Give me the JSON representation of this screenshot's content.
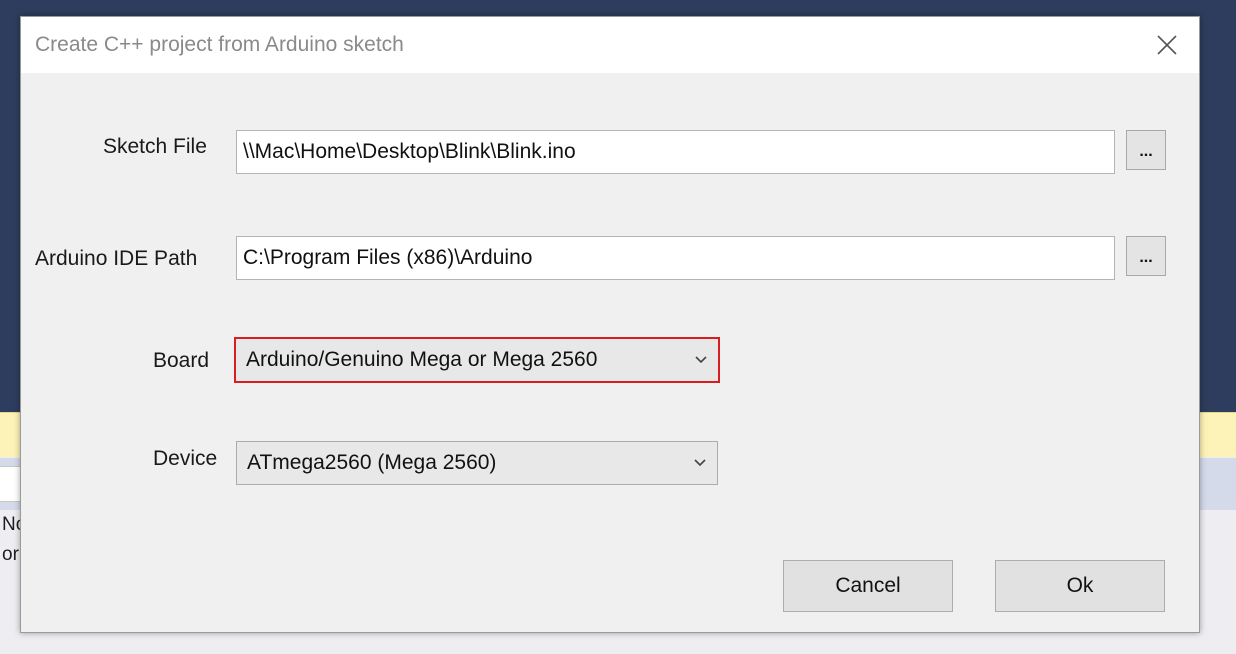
{
  "dialog": {
    "title": "Create C++ project from Arduino sketch"
  },
  "fields": {
    "sketch_file": {
      "label": "Sketch File",
      "value": "\\\\Mac\\Home\\Desktop\\Blink\\Blink.ino",
      "browse_label": "..."
    },
    "ide_path": {
      "label": "Arduino IDE Path",
      "value": "C:\\Program Files (x86)\\Arduino",
      "browse_label": "..."
    },
    "board": {
      "label": "Board",
      "selected": "Arduino/Genuino Mega or Mega 2560"
    },
    "device": {
      "label": "Device",
      "selected": "ATmega2560 (Mega 2560)"
    }
  },
  "buttons": {
    "cancel": "Cancel",
    "ok": "Ok"
  },
  "background": {
    "text_line_1": "No",
    "text_line_2": "or"
  },
  "colors": {
    "backdrop": "#2e3d5d",
    "focus_border": "#d81e1e",
    "warning_bar": "#fdf3b8"
  }
}
